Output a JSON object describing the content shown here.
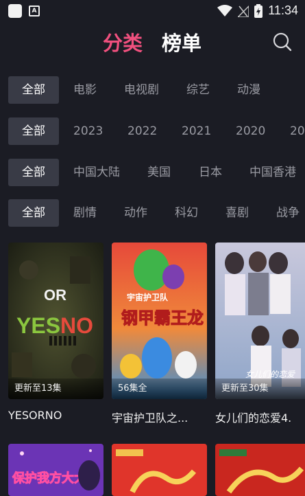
{
  "status_bar": {
    "time": "11:34"
  },
  "header": {
    "tab_category": "分类",
    "tab_ranking": "榜单"
  },
  "filters": {
    "genre": {
      "all": "全部",
      "options": [
        "电影",
        "电视剧",
        "综艺",
        "动漫"
      ]
    },
    "year": {
      "all": "全部",
      "options": [
        "2023",
        "2022",
        "2021",
        "2020",
        "20"
      ]
    },
    "region": {
      "all": "全部",
      "options": [
        "中国大陆",
        "美国",
        "日本",
        "中国香港"
      ]
    },
    "type": {
      "all": "全部",
      "options": [
        "剧情",
        "动作",
        "科幻",
        "喜剧",
        "战争"
      ]
    }
  },
  "cards": [
    {
      "badge": "更新至13集",
      "title": "YESORNO"
    },
    {
      "badge": "56集全",
      "title": "宇宙护卫队之..."
    },
    {
      "badge": "更新至30集",
      "title": "女儿们的恋爱4."
    }
  ],
  "row2_cards": [
    {
      "poster_text": "保护我方大大"
    },
    {
      "poster_text": ""
    },
    {
      "poster_text": ""
    }
  ],
  "poster_texts": {
    "yes": "YES",
    "no": "NO",
    "or": "OR",
    "title2_top": "宇宙护卫队",
    "title2_main": "钢甲霸王龙",
    "title3_tag": "女儿们的恋爱"
  }
}
